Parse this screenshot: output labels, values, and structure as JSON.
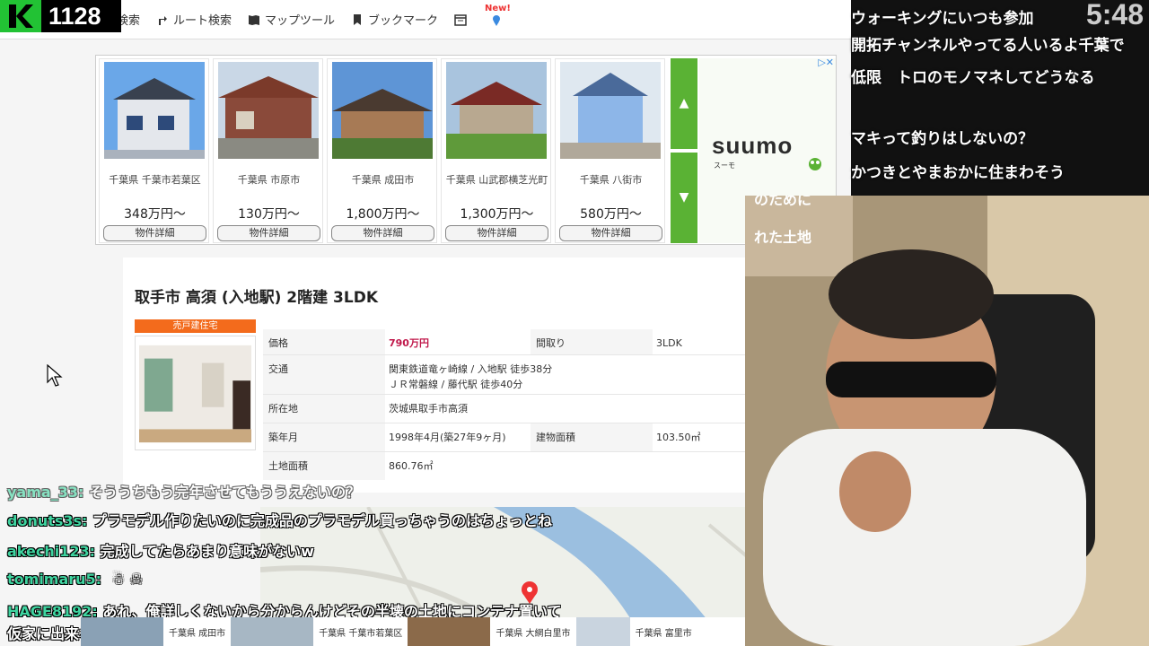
{
  "viewer": {
    "count": "1128"
  },
  "nav": {
    "items": [
      {
        "label": "検索",
        "icon": "search-icon"
      },
      {
        "label": "ルート検索",
        "icon": "route-icon"
      },
      {
        "label": "マップツール",
        "icon": "map-icon"
      },
      {
        "label": "ブックマーク",
        "icon": "bookmark-icon"
      }
    ],
    "new_badge": "New!"
  },
  "ad": {
    "cards": [
      {
        "region": "千葉県 千葉市若葉区",
        "price": "348万円〜",
        "button": "物件詳細"
      },
      {
        "region": "千葉県 市原市",
        "price": "130万円〜",
        "button": "物件詳細"
      },
      {
        "region": "千葉県 成田市",
        "price": "1,800万円〜",
        "button": "物件詳細"
      },
      {
        "region": "千葉県 山武郡横芝光町",
        "price": "1,300万円〜",
        "button": "物件詳細"
      },
      {
        "region": "千葉県 八街市",
        "price": "580万円〜",
        "button": "物件詳細"
      }
    ],
    "brand": "suumo",
    "brand_sub": "スーモ",
    "up_arrow": "▲",
    "down_arrow": "▼",
    "close": "▷✕"
  },
  "listing": {
    "title": "取手市 高須 (入地駅) 2階建 3LDK",
    "type_badge": "売戸建住宅",
    "rows": {
      "price_label": "価格",
      "price_value": "790万円",
      "layout_label": "間取り",
      "layout_value": "3LDK",
      "access_label": "交通",
      "access_value_1": "関東鉄道竜ヶ崎線 / 入地駅 徒歩38分",
      "access_value_2": "ＪＲ常磐線 / 藤代駅 徒歩40分",
      "address_label": "所在地",
      "address_value": "茨城県取手市高須",
      "built_label": "築年月",
      "built_value": "1998年4月(築27年9ヶ月)",
      "floor_label": "建物面積",
      "floor_value": "103.50㎡",
      "land_label": "土地面積",
      "land_value": "860.76㎡"
    }
  },
  "overlay": {
    "clock": "5:48",
    "lines": [
      "ウォーキングにいつも参加",
      "開拓チャンネルやってる人いるよ千葉で",
      "低限　トロのモノマネしてどうなる",
      "マキって釣りはしないの？",
      "かつきとやまおかに住まわそう",
      "のために",
      "れた土地"
    ]
  },
  "chat": [
    {
      "user": "yama_33:",
      "msg": "そううちもう完年させてもううえないの？"
    },
    {
      "user": "donuts3s:",
      "msg": "プラモデル作りたいのに完成品のプラモデル買っちゃうのはちょっとね"
    },
    {
      "user": "akechi123:",
      "msg": "完成してたらあまり意味がないw"
    },
    {
      "user": "tomimaru5:",
      "msg": ""
    },
    {
      "user": "HAGE8192:",
      "msg": "あれ、俺詳しくないから分からんけどその半壊の土地にコンテナ置いて"
    },
    {
      "user": "",
      "msg": "仮家に出来ないかな"
    }
  ],
  "strip": [
    {
      "label": "千葉県 成田市"
    },
    {
      "label": "千葉県 千葉市若葉区"
    },
    {
      "label": "千葉県 大網白里市"
    },
    {
      "label": "千葉県 富里市"
    }
  ],
  "colors": {
    "accent_green": "#5ab234",
    "badge_orange": "#f36b1c",
    "price_red": "#c0174a",
    "viewer_green": "#22c234"
  }
}
